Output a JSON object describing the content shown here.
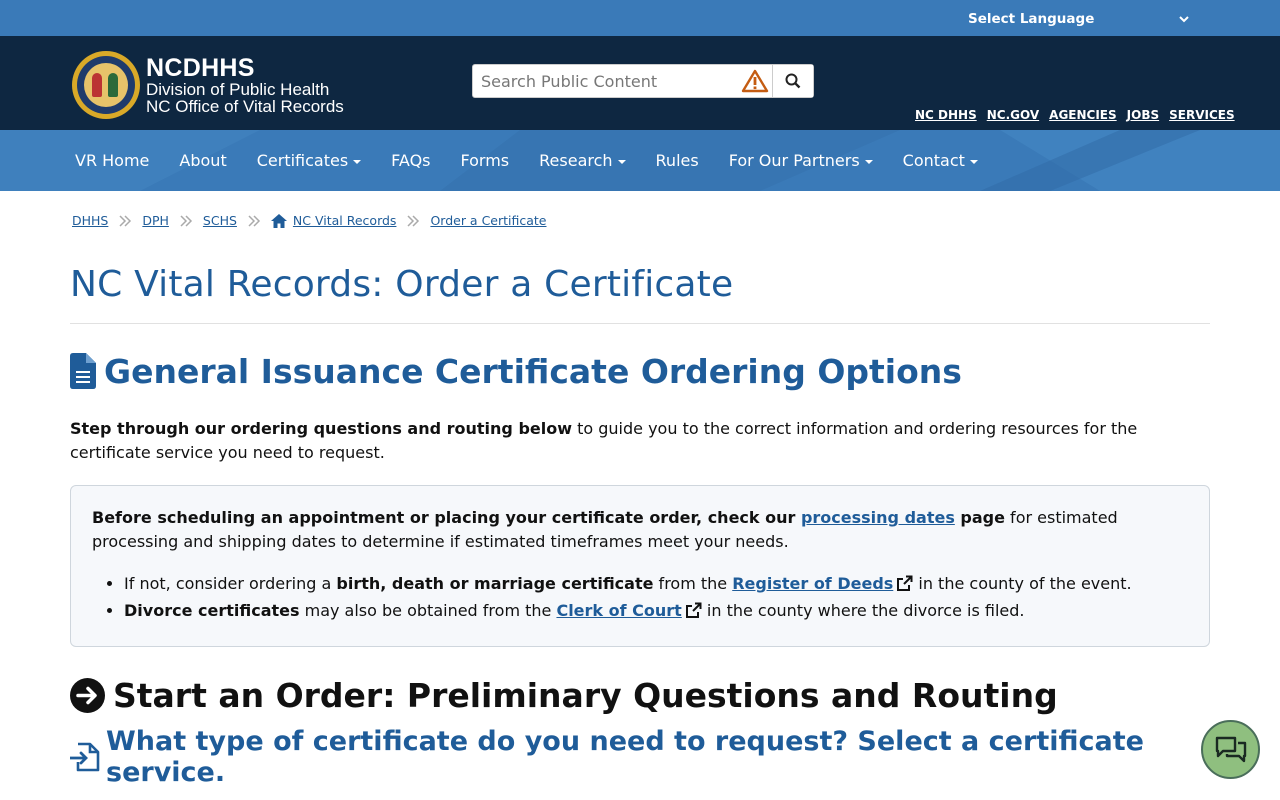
{
  "language": {
    "label": "Select Language"
  },
  "header": {
    "logo_line1": "NCDHHS",
    "logo_line2": "Division of Public Health",
    "logo_line3": "NC Office of Vital Records",
    "search_placeholder": "Search Public Content",
    "util_links": [
      "NC DHHS",
      "NC.GOV",
      "AGENCIES",
      "JOBS",
      "SERVICES"
    ]
  },
  "nav": {
    "items": [
      {
        "label": "VR Home",
        "dropdown": false
      },
      {
        "label": "About",
        "dropdown": false
      },
      {
        "label": "Certificates",
        "dropdown": true
      },
      {
        "label": "FAQs",
        "dropdown": false
      },
      {
        "label": "Forms",
        "dropdown": false
      },
      {
        "label": "Research",
        "dropdown": true
      },
      {
        "label": "Rules",
        "dropdown": false
      },
      {
        "label": "For Our Partners",
        "dropdown": true
      },
      {
        "label": "Contact",
        "dropdown": true
      }
    ]
  },
  "breadcrumb": [
    "DHHS",
    "DPH",
    "SCHS",
    "NC Vital Records",
    "Order a Certificate"
  ],
  "main": {
    "title": "NC Vital Records: Order a Certificate",
    "section1_title": "General Issuance Certificate Ordering Options",
    "intro_bold": "Step through our ordering questions and routing below",
    "intro_rest": " to guide you to the correct information and ordering resources for the certificate service you need to request.",
    "callout": {
      "p_bold1": "Before scheduling an appointment or placing your certificate order, check our ",
      "p_link": "processing dates",
      "p_bold2": " page",
      "p_rest": " for estimated processing and shipping dates to determine if estimated timeframes meet your needs.",
      "li1_pre": "If not, consider ordering a ",
      "li1_bold": "birth, death or marriage certificate",
      "li1_mid": " from the ",
      "li1_link": "Register of Deeds",
      "li1_post": " in the county of the event.",
      "li2_bold": "Divorce certificates",
      "li2_mid": " may also be obtained from the ",
      "li2_link": "Clerk of Court",
      "li2_post": " in the county where the divorce is filed."
    },
    "section2_title": "Start an Order: Preliminary Questions and Routing",
    "section3_title": "What type of certificate do you need to request? Select a certificate service."
  },
  "colors": {
    "top_bar": "#3a7ab8",
    "header": "#0e2741",
    "link": "#1f5c99",
    "chat": "#8fbf7f"
  }
}
